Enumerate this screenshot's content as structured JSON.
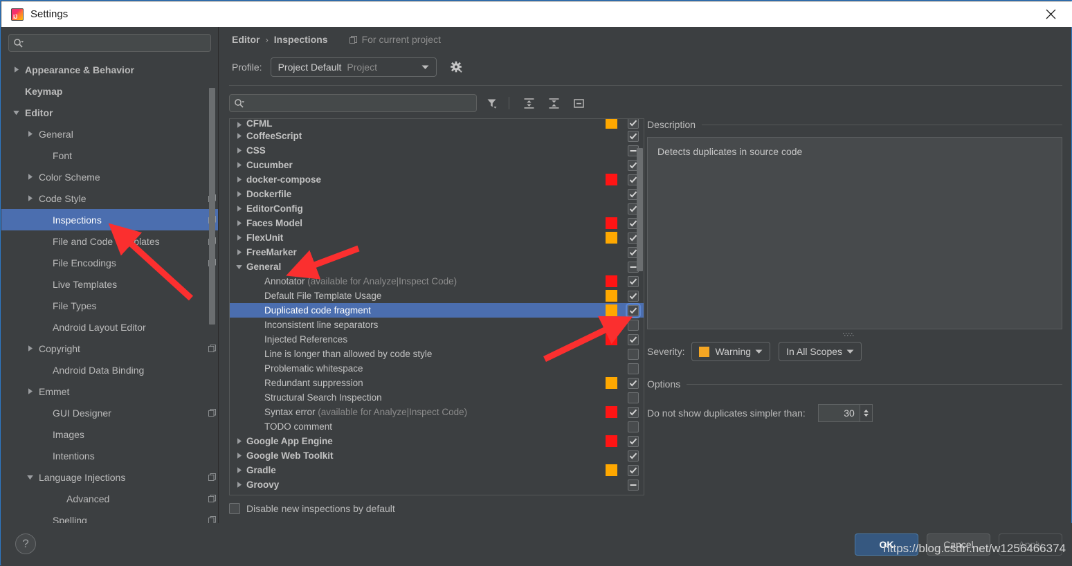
{
  "window": {
    "title": "Settings",
    "app_icon": "intellij-idea-icon",
    "close_icon": "close-icon"
  },
  "sidebar": {
    "search": {
      "placeholder": "",
      "value": "",
      "icon": "search-icon"
    },
    "items": [
      {
        "label": "Appearance & Behavior",
        "indent": 0,
        "twisty": "collapsed",
        "bold": true,
        "selected": false,
        "project_icon": false
      },
      {
        "label": "Keymap",
        "indent": 0,
        "twisty": "none",
        "bold": true,
        "selected": false,
        "project_icon": false
      },
      {
        "label": "Editor",
        "indent": 0,
        "twisty": "expanded",
        "bold": true,
        "selected": false,
        "project_icon": false
      },
      {
        "label": "General",
        "indent": 1,
        "twisty": "collapsed",
        "bold": false,
        "selected": false,
        "project_icon": false
      },
      {
        "label": "Font",
        "indent": 2,
        "twisty": "none",
        "bold": false,
        "selected": false,
        "project_icon": false
      },
      {
        "label": "Color Scheme",
        "indent": 1,
        "twisty": "collapsed",
        "bold": false,
        "selected": false,
        "project_icon": false
      },
      {
        "label": "Code Style",
        "indent": 1,
        "twisty": "collapsed",
        "bold": false,
        "selected": false,
        "project_icon": true
      },
      {
        "label": "Inspections",
        "indent": 2,
        "twisty": "none",
        "bold": false,
        "selected": true,
        "project_icon": true
      },
      {
        "label": "File and Code Templates",
        "indent": 2,
        "twisty": "none",
        "bold": false,
        "selected": false,
        "project_icon": true
      },
      {
        "label": "File Encodings",
        "indent": 2,
        "twisty": "none",
        "bold": false,
        "selected": false,
        "project_icon": true
      },
      {
        "label": "Live Templates",
        "indent": 2,
        "twisty": "none",
        "bold": false,
        "selected": false,
        "project_icon": false
      },
      {
        "label": "File Types",
        "indent": 2,
        "twisty": "none",
        "bold": false,
        "selected": false,
        "project_icon": false
      },
      {
        "label": "Android Layout Editor",
        "indent": 2,
        "twisty": "none",
        "bold": false,
        "selected": false,
        "project_icon": false
      },
      {
        "label": "Copyright",
        "indent": 1,
        "twisty": "collapsed",
        "bold": false,
        "selected": false,
        "project_icon": true
      },
      {
        "label": "Android Data Binding",
        "indent": 2,
        "twisty": "none",
        "bold": false,
        "selected": false,
        "project_icon": false
      },
      {
        "label": "Emmet",
        "indent": 1,
        "twisty": "collapsed",
        "bold": false,
        "selected": false,
        "project_icon": false
      },
      {
        "label": "GUI Designer",
        "indent": 2,
        "twisty": "none",
        "bold": false,
        "selected": false,
        "project_icon": true
      },
      {
        "label": "Images",
        "indent": 2,
        "twisty": "none",
        "bold": false,
        "selected": false,
        "project_icon": false
      },
      {
        "label": "Intentions",
        "indent": 2,
        "twisty": "none",
        "bold": false,
        "selected": false,
        "project_icon": false
      },
      {
        "label": "Language Injections",
        "indent": 1,
        "twisty": "expanded",
        "bold": false,
        "selected": false,
        "project_icon": true
      },
      {
        "label": "Advanced",
        "indent": 3,
        "twisty": "none",
        "bold": false,
        "selected": false,
        "project_icon": true
      },
      {
        "label": "Spelling",
        "indent": 2,
        "twisty": "none",
        "bold": false,
        "selected": false,
        "project_icon": true
      }
    ]
  },
  "header": {
    "breadcrumb": {
      "parent": "Editor",
      "separator": "›",
      "current": "Inspections"
    },
    "for_current_project": {
      "label": "For current project",
      "icon": "project-scope-icon"
    },
    "profile": {
      "label": "Profile:",
      "value": "Project Default",
      "value_suffix": "Project",
      "dropdown_icon": "chevron-down-icon",
      "gear_icon": "gear-icon"
    }
  },
  "toolbar": {
    "search": {
      "placeholder": "",
      "value": "",
      "icon": "search-icon"
    },
    "buttons": [
      {
        "name": "filter-icon",
        "tooltip": "Filter Inspections"
      },
      {
        "name": "expand-all-icon",
        "tooltip": "Expand All"
      },
      {
        "name": "collapse-all-icon",
        "tooltip": "Collapse All"
      },
      {
        "name": "show-only-enabled-icon",
        "tooltip": "Show Only Enabled"
      }
    ]
  },
  "inspections": {
    "rows": [
      {
        "label": "CFML",
        "sub": "",
        "type": "group",
        "indent": 0,
        "twisty": "collapsed",
        "severity": "warning",
        "check": "checked",
        "selected": false,
        "clipped": true
      },
      {
        "label": "CoffeeScript",
        "sub": "",
        "type": "group",
        "indent": 0,
        "twisty": "collapsed",
        "severity": "none",
        "check": "checked",
        "selected": false
      },
      {
        "label": "CSS",
        "sub": "",
        "type": "group",
        "indent": 0,
        "twisty": "collapsed",
        "severity": "none",
        "check": "indeterminate",
        "selected": false
      },
      {
        "label": "Cucumber",
        "sub": "",
        "type": "group",
        "indent": 0,
        "twisty": "collapsed",
        "severity": "none",
        "check": "checked",
        "selected": false
      },
      {
        "label": "docker-compose",
        "sub": "",
        "type": "group",
        "indent": 0,
        "twisty": "collapsed",
        "severity": "error",
        "check": "checked",
        "selected": false
      },
      {
        "label": "Dockerfile",
        "sub": "",
        "type": "group",
        "indent": 0,
        "twisty": "collapsed",
        "severity": "none",
        "check": "checked",
        "selected": false
      },
      {
        "label": "EditorConfig",
        "sub": "",
        "type": "group",
        "indent": 0,
        "twisty": "collapsed",
        "severity": "none",
        "check": "checked",
        "selected": false
      },
      {
        "label": "Faces Model",
        "sub": "",
        "type": "group",
        "indent": 0,
        "twisty": "collapsed",
        "severity": "error",
        "check": "checked",
        "selected": false
      },
      {
        "label": "FlexUnit",
        "sub": "",
        "type": "group",
        "indent": 0,
        "twisty": "collapsed",
        "severity": "warning",
        "check": "checked",
        "selected": false
      },
      {
        "label": "FreeMarker",
        "sub": "",
        "type": "group",
        "indent": 0,
        "twisty": "collapsed",
        "severity": "none",
        "check": "checked",
        "selected": false
      },
      {
        "label": "General",
        "sub": "",
        "type": "group",
        "indent": 0,
        "twisty": "expanded",
        "severity": "none",
        "check": "indeterminate",
        "selected": false
      },
      {
        "label": "Annotator",
        "sub": "(available for Analyze|Inspect Code)",
        "type": "leaf",
        "indent": 1,
        "twisty": "none",
        "severity": "error",
        "check": "checked",
        "selected": false
      },
      {
        "label": "Default File Template Usage",
        "sub": "",
        "type": "leaf",
        "indent": 1,
        "twisty": "none",
        "severity": "warning",
        "check": "checked",
        "selected": false
      },
      {
        "label": "Duplicated code fragment",
        "sub": "",
        "type": "leaf",
        "indent": 1,
        "twisty": "none",
        "severity": "warning",
        "check": "checked",
        "selected": true
      },
      {
        "label": "Inconsistent line separators",
        "sub": "",
        "type": "leaf",
        "indent": 1,
        "twisty": "none",
        "severity": "none",
        "check": "unchecked",
        "selected": false
      },
      {
        "label": "Injected References",
        "sub": "",
        "type": "leaf",
        "indent": 1,
        "twisty": "none",
        "severity": "error",
        "check": "checked",
        "selected": false
      },
      {
        "label": "Line is longer than allowed by code style",
        "sub": "",
        "type": "leaf",
        "indent": 1,
        "twisty": "none",
        "severity": "none",
        "check": "unchecked",
        "selected": false
      },
      {
        "label": "Problematic whitespace",
        "sub": "",
        "type": "leaf",
        "indent": 1,
        "twisty": "none",
        "severity": "none",
        "check": "unchecked",
        "selected": false
      },
      {
        "label": "Redundant suppression",
        "sub": "",
        "type": "leaf",
        "indent": 1,
        "twisty": "none",
        "severity": "warning",
        "check": "checked",
        "selected": false
      },
      {
        "label": "Structural Search Inspection",
        "sub": "",
        "type": "leaf",
        "indent": 1,
        "twisty": "none",
        "severity": "none",
        "check": "unchecked",
        "selected": false
      },
      {
        "label": "Syntax error",
        "sub": "(available for Analyze|Inspect Code)",
        "type": "leaf",
        "indent": 1,
        "twisty": "none",
        "severity": "error",
        "check": "checked",
        "selected": false
      },
      {
        "label": "TODO comment",
        "sub": "",
        "type": "leaf",
        "indent": 1,
        "twisty": "none",
        "severity": "none",
        "check": "unchecked",
        "selected": false
      },
      {
        "label": "Google App Engine",
        "sub": "",
        "type": "group",
        "indent": 0,
        "twisty": "collapsed",
        "severity": "error",
        "check": "checked",
        "selected": false
      },
      {
        "label": "Google Web Toolkit",
        "sub": "",
        "type": "group",
        "indent": 0,
        "twisty": "collapsed",
        "severity": "none",
        "check": "checked",
        "selected": false
      },
      {
        "label": "Gradle",
        "sub": "",
        "type": "group",
        "indent": 0,
        "twisty": "collapsed",
        "severity": "warning",
        "check": "checked",
        "selected": false
      },
      {
        "label": "Groovy",
        "sub": "",
        "type": "group",
        "indent": 0,
        "twisty": "collapsed",
        "severity": "none",
        "check": "indeterminate",
        "selected": false
      }
    ],
    "disable_new": {
      "label": "Disable new inspections by default",
      "checked": false
    }
  },
  "detail": {
    "description": {
      "title": "Description",
      "text": "Detects duplicates in source code"
    },
    "severity": {
      "label": "Severity:",
      "value": "Warning",
      "chip_color": "#f5a623",
      "dropdown_icon": "chevron-down-icon",
      "scope_value": "In All Scopes",
      "scope_dropdown_icon": "chevron-down-icon"
    },
    "options": {
      "title": "Options",
      "rows": [
        {
          "label": "Do not show duplicates simpler than:",
          "value": "30",
          "control": "spinner"
        }
      ]
    }
  },
  "footer": {
    "help_label": "?",
    "ok": "OK",
    "cancel": "Cancel",
    "apply": "Apply"
  },
  "watermark": "https://blog.csdn.net/w1256466374",
  "colors": {
    "severity_warning": "#ffa800",
    "severity_error": "#ff1414",
    "selection": "#4b6eaf",
    "accent_border": "#2d79c7",
    "annotation_arrow": "#fb2f2f"
  }
}
